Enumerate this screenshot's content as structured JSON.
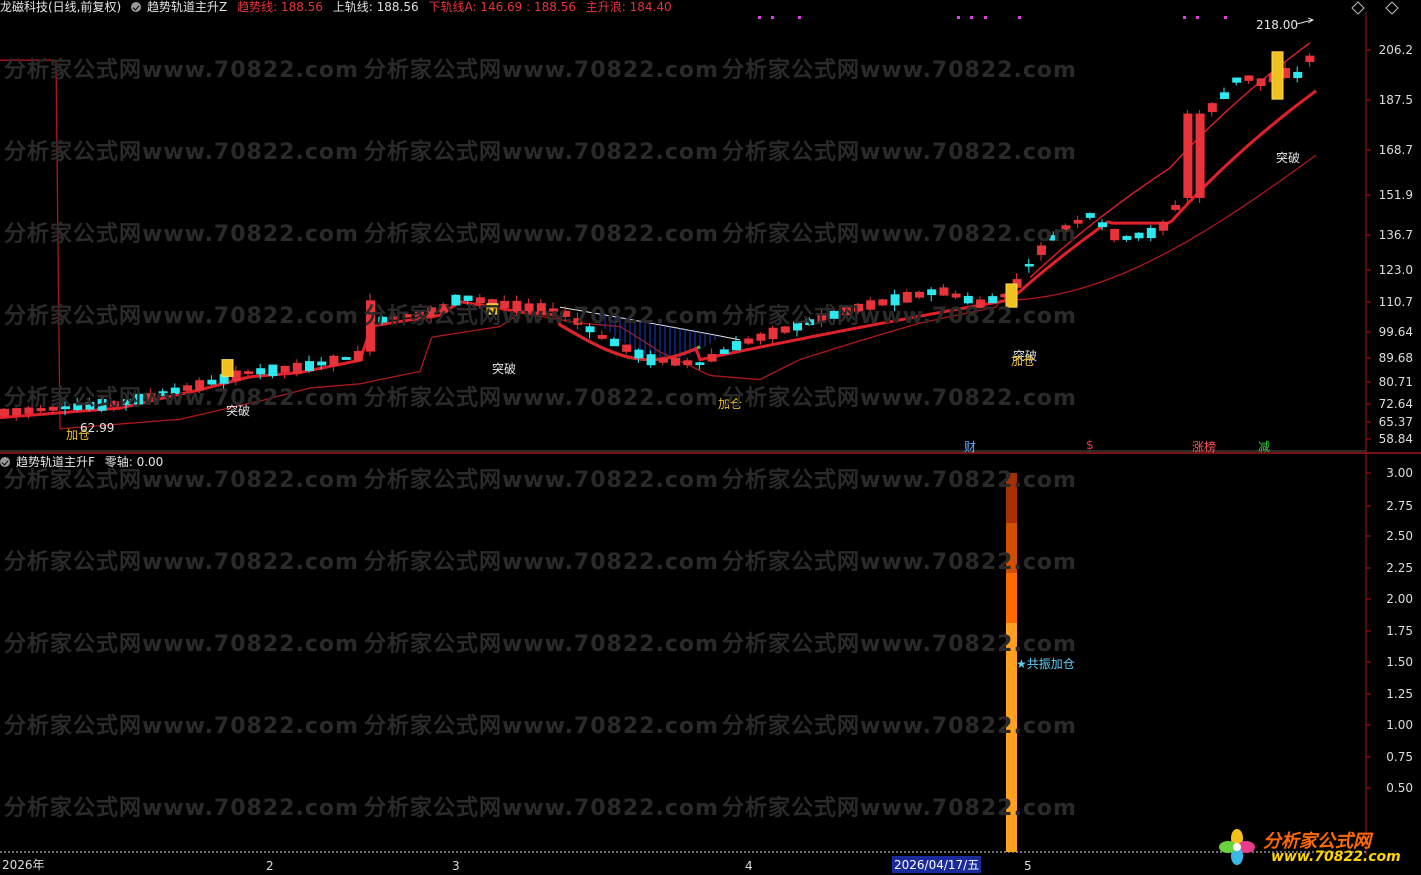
{
  "header": {
    "title": "龙磁科技(日线,前复权)",
    "indicator": "趋势轨道主升Z",
    "items": [
      {
        "text": "趋势线: 188.56",
        "color": "#e8333a"
      },
      {
        "text": "上轨线: 188.56",
        "color": "#e0e0e0"
      },
      {
        "text": "下轨线A: 146.69 : 188.56",
        "color": "#e8333a"
      },
      {
        "text": "主升浪: 184.40",
        "color": "#e8333a"
      }
    ]
  },
  "sub_header": {
    "indicator": "趋势轨道主升F",
    "zero": "零轴: 0.00"
  },
  "main_axis": [
    "206.2",
    "187.5",
    "168.7",
    "151.9",
    "136.7",
    "123.0",
    "110.7",
    "99.64",
    "89.68",
    "80.71",
    "72.64",
    "65.37",
    "58.84"
  ],
  "sub_axis": [
    "3.00",
    "2.75",
    "2.50",
    "2.25",
    "2.00",
    "1.75",
    "1.50",
    "1.25",
    "1.00",
    "0.75",
    "0.50"
  ],
  "x_axis": [
    "2026年",
    "2",
    "3",
    "4",
    "2026/04/17/五",
    "5"
  ],
  "annotations": {
    "high_value": "218.00",
    "low_value": "62.99",
    "breakout": "突破",
    "add": "加仓",
    "resonance": "★共振加仓",
    "events": [
      {
        "text": "财",
        "color": "#5ab0ff"
      },
      {
        "text": "$",
        "color": "#e8333a"
      },
      {
        "text": "涨榜",
        "color": "#ff5555"
      },
      {
        "text": "减",
        "color": "#3ad23a"
      }
    ]
  },
  "watermark": "分析家公式网www.70822.com",
  "logo": {
    "name": "分析家公式网",
    "url": "www.70822.com"
  },
  "colors": {
    "up": "#e8333a",
    "down": "#2ee8f0",
    "trend": "#e0202a",
    "lower": "#b01818",
    "upper": "#e8e8e8",
    "green": "#37d23a",
    "fill": "#1a3cc8"
  }
}
